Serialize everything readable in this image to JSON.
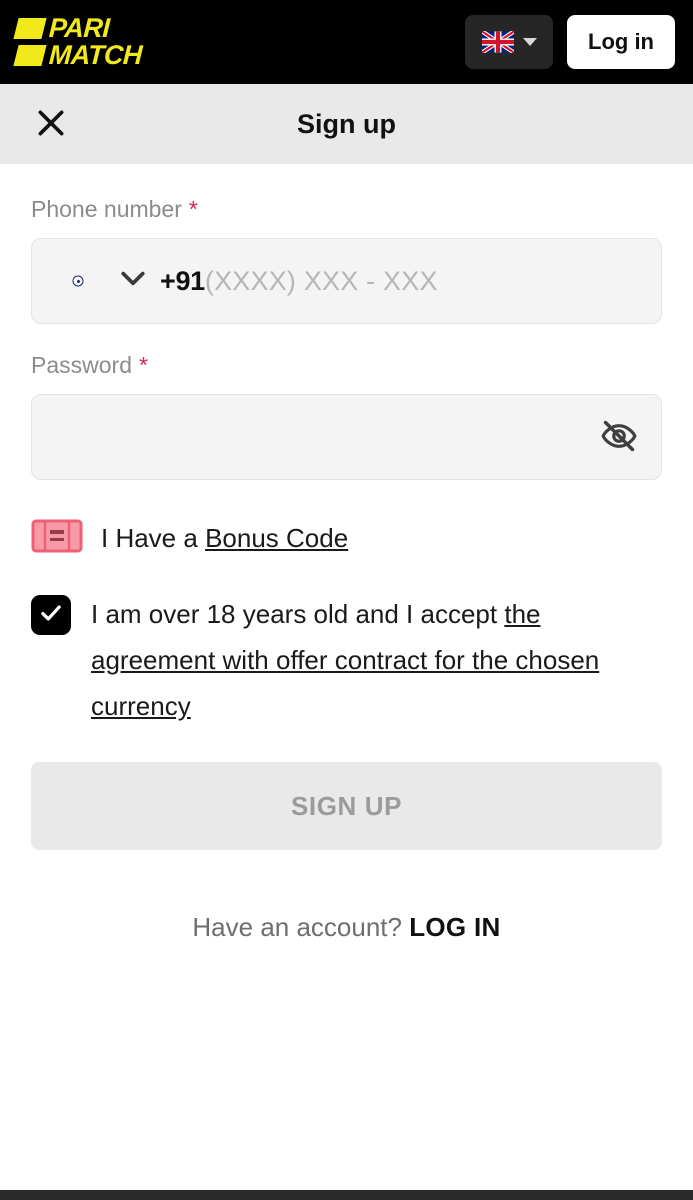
{
  "header": {
    "logo_line1": "PARI",
    "logo_line2": "MATCH",
    "language_flag": "uk-flag-icon",
    "language_caret": "chevron-down-icon",
    "login_label": "Log in"
  },
  "titlebar": {
    "close_icon": "close-icon",
    "title": "Sign up"
  },
  "form": {
    "phone": {
      "label": "Phone number",
      "required_mark": "*",
      "flag": "india-flag-icon",
      "country_caret": "chevron-down-icon",
      "dial_code": "+91",
      "placeholder": "(XXXX) XXX - XXX",
      "value": ""
    },
    "password": {
      "label": "Password",
      "required_mark": "*",
      "placeholder": "",
      "value": "",
      "toggle_icon": "eye-off-icon"
    },
    "bonus": {
      "icon": "ticket-icon",
      "prefix": "I Have a ",
      "link": "Bonus Code"
    },
    "agreement": {
      "checked": true,
      "check_icon": "check-icon",
      "prefix": "I am over 18 years old and I accept ",
      "link": "the agreement with offer contract for the chosen currency"
    },
    "submit_label": "SIGN UP"
  },
  "footer": {
    "prompt": "Have an account? ",
    "login_link": "LOG IN"
  },
  "colors": {
    "brand_yellow": "#f2e91a",
    "header_black": "#000000",
    "titlebar_gray": "#e9e9e9",
    "required_red": "#d6274f",
    "ticket_pink": "#f4808f",
    "input_gray": "#f4f4f4",
    "disabled_text": "#9b9b9b"
  }
}
